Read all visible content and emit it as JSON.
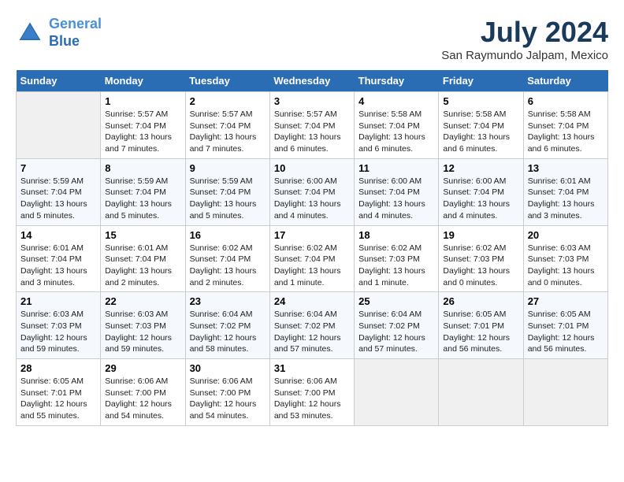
{
  "header": {
    "logo_line1": "General",
    "logo_line2": "Blue",
    "month": "July 2024",
    "location": "San Raymundo Jalpam, Mexico"
  },
  "days_of_week": [
    "Sunday",
    "Monday",
    "Tuesday",
    "Wednesday",
    "Thursday",
    "Friday",
    "Saturday"
  ],
  "weeks": [
    [
      {
        "day": "",
        "empty": true
      },
      {
        "day": "1",
        "sunrise": "Sunrise: 5:57 AM",
        "sunset": "Sunset: 7:04 PM",
        "daylight": "Daylight: 13 hours and 7 minutes."
      },
      {
        "day": "2",
        "sunrise": "Sunrise: 5:57 AM",
        "sunset": "Sunset: 7:04 PM",
        "daylight": "Daylight: 13 hours and 7 minutes."
      },
      {
        "day": "3",
        "sunrise": "Sunrise: 5:57 AM",
        "sunset": "Sunset: 7:04 PM",
        "daylight": "Daylight: 13 hours and 6 minutes."
      },
      {
        "day": "4",
        "sunrise": "Sunrise: 5:58 AM",
        "sunset": "Sunset: 7:04 PM",
        "daylight": "Daylight: 13 hours and 6 minutes."
      },
      {
        "day": "5",
        "sunrise": "Sunrise: 5:58 AM",
        "sunset": "Sunset: 7:04 PM",
        "daylight": "Daylight: 13 hours and 6 minutes."
      },
      {
        "day": "6",
        "sunrise": "Sunrise: 5:58 AM",
        "sunset": "Sunset: 7:04 PM",
        "daylight": "Daylight: 13 hours and 6 minutes."
      }
    ],
    [
      {
        "day": "7",
        "sunrise": "Sunrise: 5:59 AM",
        "sunset": "Sunset: 7:04 PM",
        "daylight": "Daylight: 13 hours and 5 minutes."
      },
      {
        "day": "8",
        "sunrise": "Sunrise: 5:59 AM",
        "sunset": "Sunset: 7:04 PM",
        "daylight": "Daylight: 13 hours and 5 minutes."
      },
      {
        "day": "9",
        "sunrise": "Sunrise: 5:59 AM",
        "sunset": "Sunset: 7:04 PM",
        "daylight": "Daylight: 13 hours and 5 minutes."
      },
      {
        "day": "10",
        "sunrise": "Sunrise: 6:00 AM",
        "sunset": "Sunset: 7:04 PM",
        "daylight": "Daylight: 13 hours and 4 minutes."
      },
      {
        "day": "11",
        "sunrise": "Sunrise: 6:00 AM",
        "sunset": "Sunset: 7:04 PM",
        "daylight": "Daylight: 13 hours and 4 minutes."
      },
      {
        "day": "12",
        "sunrise": "Sunrise: 6:00 AM",
        "sunset": "Sunset: 7:04 PM",
        "daylight": "Daylight: 13 hours and 4 minutes."
      },
      {
        "day": "13",
        "sunrise": "Sunrise: 6:01 AM",
        "sunset": "Sunset: 7:04 PM",
        "daylight": "Daylight: 13 hours and 3 minutes."
      }
    ],
    [
      {
        "day": "14",
        "sunrise": "Sunrise: 6:01 AM",
        "sunset": "Sunset: 7:04 PM",
        "daylight": "Daylight: 13 hours and 3 minutes."
      },
      {
        "day": "15",
        "sunrise": "Sunrise: 6:01 AM",
        "sunset": "Sunset: 7:04 PM",
        "daylight": "Daylight: 13 hours and 2 minutes."
      },
      {
        "day": "16",
        "sunrise": "Sunrise: 6:02 AM",
        "sunset": "Sunset: 7:04 PM",
        "daylight": "Daylight: 13 hours and 2 minutes."
      },
      {
        "day": "17",
        "sunrise": "Sunrise: 6:02 AM",
        "sunset": "Sunset: 7:04 PM",
        "daylight": "Daylight: 13 hours and 1 minute."
      },
      {
        "day": "18",
        "sunrise": "Sunrise: 6:02 AM",
        "sunset": "Sunset: 7:03 PM",
        "daylight": "Daylight: 13 hours and 1 minute."
      },
      {
        "day": "19",
        "sunrise": "Sunrise: 6:02 AM",
        "sunset": "Sunset: 7:03 PM",
        "daylight": "Daylight: 13 hours and 0 minutes."
      },
      {
        "day": "20",
        "sunrise": "Sunrise: 6:03 AM",
        "sunset": "Sunset: 7:03 PM",
        "daylight": "Daylight: 13 hours and 0 minutes."
      }
    ],
    [
      {
        "day": "21",
        "sunrise": "Sunrise: 6:03 AM",
        "sunset": "Sunset: 7:03 PM",
        "daylight": "Daylight: 12 hours and 59 minutes."
      },
      {
        "day": "22",
        "sunrise": "Sunrise: 6:03 AM",
        "sunset": "Sunset: 7:03 PM",
        "daylight": "Daylight: 12 hours and 59 minutes."
      },
      {
        "day": "23",
        "sunrise": "Sunrise: 6:04 AM",
        "sunset": "Sunset: 7:02 PM",
        "daylight": "Daylight: 12 hours and 58 minutes."
      },
      {
        "day": "24",
        "sunrise": "Sunrise: 6:04 AM",
        "sunset": "Sunset: 7:02 PM",
        "daylight": "Daylight: 12 hours and 57 minutes."
      },
      {
        "day": "25",
        "sunrise": "Sunrise: 6:04 AM",
        "sunset": "Sunset: 7:02 PM",
        "daylight": "Daylight: 12 hours and 57 minutes."
      },
      {
        "day": "26",
        "sunrise": "Sunrise: 6:05 AM",
        "sunset": "Sunset: 7:01 PM",
        "daylight": "Daylight: 12 hours and 56 minutes."
      },
      {
        "day": "27",
        "sunrise": "Sunrise: 6:05 AM",
        "sunset": "Sunset: 7:01 PM",
        "daylight": "Daylight: 12 hours and 56 minutes."
      }
    ],
    [
      {
        "day": "28",
        "sunrise": "Sunrise: 6:05 AM",
        "sunset": "Sunset: 7:01 PM",
        "daylight": "Daylight: 12 hours and 55 minutes."
      },
      {
        "day": "29",
        "sunrise": "Sunrise: 6:06 AM",
        "sunset": "Sunset: 7:00 PM",
        "daylight": "Daylight: 12 hours and 54 minutes."
      },
      {
        "day": "30",
        "sunrise": "Sunrise: 6:06 AM",
        "sunset": "Sunset: 7:00 PM",
        "daylight": "Daylight: 12 hours and 54 minutes."
      },
      {
        "day": "31",
        "sunrise": "Sunrise: 6:06 AM",
        "sunset": "Sunset: 7:00 PM",
        "daylight": "Daylight: 12 hours and 53 minutes."
      },
      {
        "day": "",
        "empty": true
      },
      {
        "day": "",
        "empty": true
      },
      {
        "day": "",
        "empty": true
      }
    ]
  ]
}
